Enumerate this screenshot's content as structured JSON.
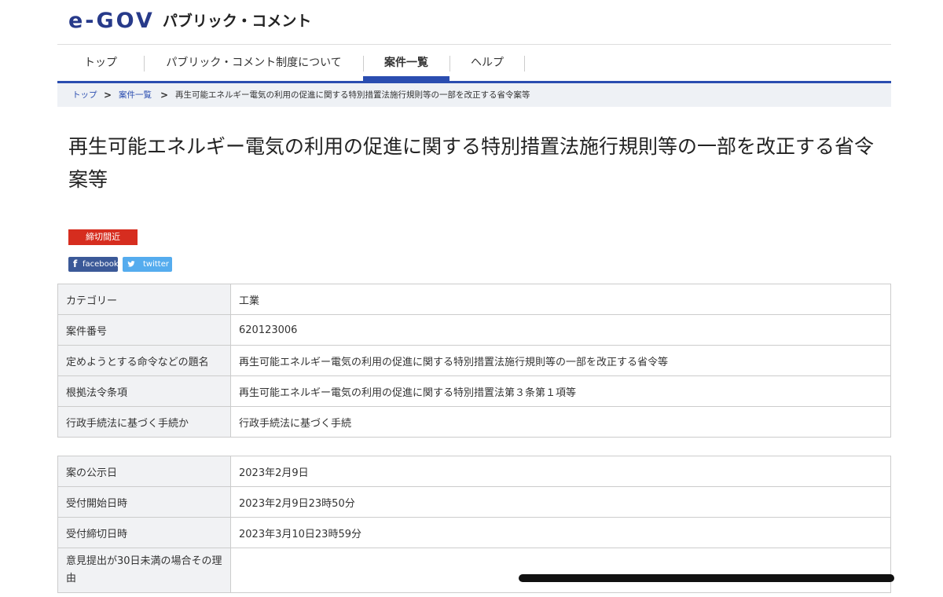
{
  "header": {
    "logo_mark": "e-GOV",
    "logo_text": "パブリック・コメント"
  },
  "nav": {
    "items": [
      {
        "label": "トップ"
      },
      {
        "label": "パブリック・コメント制度について"
      },
      {
        "label": "案件一覧"
      },
      {
        "label": "ヘルプ"
      }
    ],
    "active": "案件一覧"
  },
  "breadcrumb": {
    "items": [
      "トップ",
      "案件一覧",
      "再生可能エネルギー電気の利用の促進に関する特別措置法施行規則等の一部を改正する省令案等"
    ],
    "separator": ">"
  },
  "page_title": "再生可能エネルギー電気の利用の促進に関する特別措置法施行規則等の一部を改正する省令案等",
  "status_badge": "締切間近",
  "share": {
    "facebook": "facebook",
    "twitter": "twitter"
  },
  "table1": [
    {
      "key": "カテゴリー",
      "value": "工業"
    },
    {
      "key": "案件番号",
      "value": "620123006"
    },
    {
      "key": "定めようとする命令などの題名",
      "value": "再生可能エネルギー電気の利用の促進に関する特別措置法施行規則等の一部を改正する省令等"
    },
    {
      "key": "根拠法令条項",
      "value": "再生可能エネルギー電気の利用の促進に関する特別措置法第３条第１項等"
    },
    {
      "key": "行政手続法に基づく手続か",
      "value": "行政手続法に基づく手続"
    }
  ],
  "table2": [
    {
      "key": "案の公示日",
      "value": "2023年2月9日"
    },
    {
      "key": "受付開始日時",
      "value": "2023年2月9日23時50分"
    },
    {
      "key": "受付締切日時",
      "value": "2023年3月10日23時59分"
    },
    {
      "key": "意見提出が30日未満の場合その理由",
      "value": ""
    }
  ],
  "colors": {
    "brand": "#273a8a",
    "nav_accent": "#2a4db0",
    "badge": "#d62d1f",
    "facebook": "#3b5998",
    "twitter": "#55acee"
  },
  "icons": [
    "facebook-icon",
    "twitter-icon",
    "chevron-right-icon"
  ]
}
